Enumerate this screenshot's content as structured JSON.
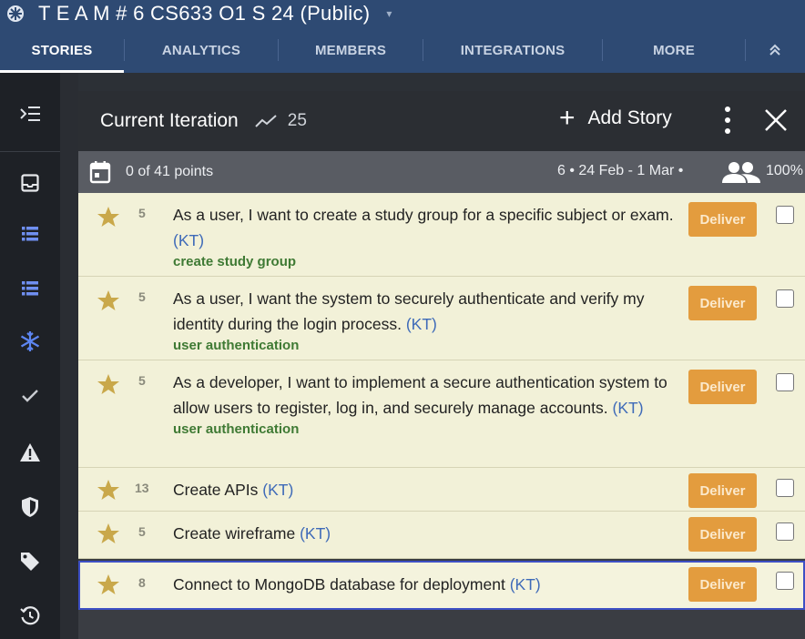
{
  "app": {
    "title": "T E A M # 6 CS633 O1 S 24  (Public)"
  },
  "tabs": [
    {
      "label": "STORIES"
    },
    {
      "label": "ANALYTICS"
    },
    {
      "label": "MEMBERS"
    },
    {
      "label": "INTEGRATIONS"
    },
    {
      "label": "MORE"
    }
  ],
  "panel": {
    "title": "Current Iteration",
    "velocity": "25",
    "add_story_label": "Add Story",
    "points_summary": "0 of 41 points",
    "iteration_dates": "6 • 24 Feb - 1 Mar •",
    "team_strength": "100%"
  },
  "stories": [
    {
      "estimate": "5",
      "text": "As a user, I want to create a study group for a specific subject or exam.",
      "owner": "(KT)",
      "label": "create study group",
      "action": "Deliver"
    },
    {
      "estimate": "5",
      "text": "As a user, I want the system to securely authenticate and verify my identity during the login process.",
      "owner": "(KT)",
      "label": "user authentication",
      "action": "Deliver"
    },
    {
      "estimate": "5",
      "text": "As a developer, I want to implement a secure authentication system to allow users to register, log in, and securely manage accounts.",
      "owner": "(KT)",
      "label": "user authentication",
      "action": "Deliver"
    },
    {
      "estimate": "13",
      "text": "Create APIs",
      "owner": "(KT)",
      "label": "",
      "action": "Deliver"
    },
    {
      "estimate": "5",
      "text": "Create wireframe",
      "owner": "(KT)",
      "label": "",
      "action": "Deliver"
    },
    {
      "estimate": "8",
      "text": "Connect to MongoDB database for deployment",
      "owner": "(KT)",
      "label": "",
      "action": "Deliver"
    }
  ],
  "colors": {
    "header_blue": "#2e4a73",
    "story_bg": "#f2f1d8",
    "deliver_orange": "#e39c3e",
    "star_gold": "#c9a84a",
    "label_green": "#3f7a34",
    "owner_blue": "#3e6ab8"
  }
}
